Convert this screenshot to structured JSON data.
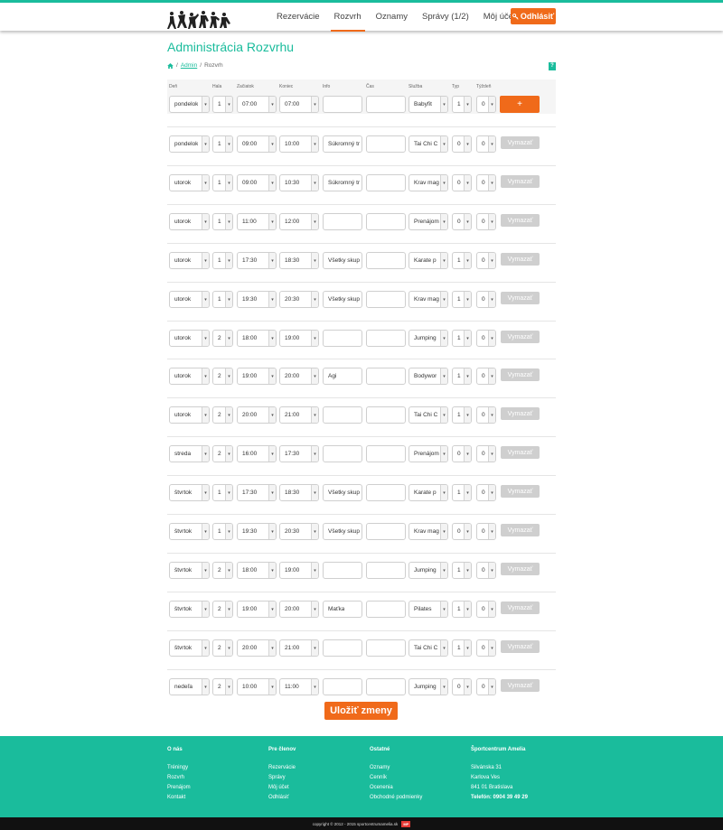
{
  "nav": {
    "items": [
      {
        "label": "Rezervácie",
        "active": false
      },
      {
        "label": "Rozvrh",
        "active": true
      },
      {
        "label": "Oznamy",
        "active": false
      },
      {
        "label": "Správy (1/2)",
        "active": false
      },
      {
        "label": "Môj účet",
        "active": false
      }
    ],
    "logout_label": "Odhlásiť"
  },
  "page": {
    "title": "Administrácia Rozvrhu",
    "breadcrumb": {
      "sep1": "/",
      "admin": "Admin",
      "sep2": "/",
      "current": "Rozvrh"
    },
    "help_label": "?"
  },
  "columns": [
    "Deň",
    "Hala",
    "Začiatok",
    "Koniec",
    "Info",
    "Čas",
    "Služba",
    "Typ",
    "Týždeň"
  ],
  "new_row": {
    "den": "pondelok",
    "hala": "1",
    "zaciatok": "07:00",
    "koniec": "07:00",
    "info": "",
    "cas": "",
    "sluzba": "Babyfit",
    "typ": "1",
    "tyzden": "0",
    "add_label": "+"
  },
  "delete_label": "Vymazať",
  "rows": [
    {
      "den": "pondelok",
      "hala": "1",
      "zaciatok": "09:00",
      "koniec": "10:00",
      "info": "Súkromný tr",
      "cas": "",
      "sluzba": "Tai Chi C",
      "typ": "0",
      "tyzden": "0"
    },
    {
      "den": "utorok",
      "hala": "1",
      "zaciatok": "09:00",
      "koniec": "10:30",
      "info": "Súkromný tr",
      "cas": "",
      "sluzba": "Krav mag",
      "typ": "0",
      "tyzden": "0"
    },
    {
      "den": "utorok",
      "hala": "1",
      "zaciatok": "11:00",
      "koniec": "12:00",
      "info": "",
      "cas": "",
      "sluzba": "Prenájom",
      "typ": "0",
      "tyzden": "0"
    },
    {
      "den": "utorok",
      "hala": "1",
      "zaciatok": "17:30",
      "koniec": "18:30",
      "info": "Všetky skup",
      "cas": "",
      "sluzba": "Karate p",
      "typ": "1",
      "tyzden": "0"
    },
    {
      "den": "utorok",
      "hala": "1",
      "zaciatok": "19:30",
      "koniec": "20:30",
      "info": "Všetky skup",
      "cas": "",
      "sluzba": "Krav mag",
      "typ": "1",
      "tyzden": "0"
    },
    {
      "den": "utorok",
      "hala": "2",
      "zaciatok": "18:00",
      "koniec": "19:00",
      "info": "",
      "cas": "",
      "sluzba": "Jumping",
      "typ": "1",
      "tyzden": "0"
    },
    {
      "den": "utorok",
      "hala": "2",
      "zaciatok": "19:00",
      "koniec": "20:00",
      "info": "Agi",
      "cas": "",
      "sluzba": "Bodywor",
      "typ": "1",
      "tyzden": "0"
    },
    {
      "den": "utorok",
      "hala": "2",
      "zaciatok": "20:00",
      "koniec": "21:00",
      "info": "",
      "cas": "",
      "sluzba": "Tai Chi C",
      "typ": "1",
      "tyzden": "0"
    },
    {
      "den": "streda",
      "hala": "2",
      "zaciatok": "16:00",
      "koniec": "17:30",
      "info": "",
      "cas": "",
      "sluzba": "Prenájom",
      "typ": "0",
      "tyzden": "0"
    },
    {
      "den": "štvrtok",
      "hala": "1",
      "zaciatok": "17:30",
      "koniec": "18:30",
      "info": "Všetky skup",
      "cas": "",
      "sluzba": "Karate p",
      "typ": "1",
      "tyzden": "0"
    },
    {
      "den": "štvrtok",
      "hala": "1",
      "zaciatok": "19:30",
      "koniec": "20:30",
      "info": "Všetky skup",
      "cas": "",
      "sluzba": "Krav mag",
      "typ": "0",
      "tyzden": "0"
    },
    {
      "den": "štvrtok",
      "hala": "2",
      "zaciatok": "18:00",
      "koniec": "19:00",
      "info": "",
      "cas": "",
      "sluzba": "Jumping",
      "typ": "1",
      "tyzden": "0"
    },
    {
      "den": "štvrtok",
      "hala": "2",
      "zaciatok": "19:00",
      "koniec": "20:00",
      "info": "Maťka",
      "cas": "",
      "sluzba": "Pilates",
      "typ": "1",
      "tyzden": "0"
    },
    {
      "den": "štvrtok",
      "hala": "2",
      "zaciatok": "20:00",
      "koniec": "21:00",
      "info": "",
      "cas": "",
      "sluzba": "Tai Chi C",
      "typ": "1",
      "tyzden": "0"
    },
    {
      "den": "nedeľa",
      "hala": "2",
      "zaciatok": "10:00",
      "koniec": "11:00",
      "info": "",
      "cas": "",
      "sluzba": "Jumping",
      "typ": "0",
      "tyzden": "0"
    }
  ],
  "save_label": "Uložiť zmeny",
  "footer": {
    "cols": [
      {
        "title": "O nás",
        "items": [
          "Tréningy",
          "Rozvrh",
          "Prenájom",
          "Kontakt"
        ]
      },
      {
        "title": "Pre členov",
        "items": [
          "Rezervácie",
          "Správy",
          "Môj účet",
          "Odhlásiť"
        ]
      },
      {
        "title": "Ostatné",
        "items": [
          "Oznamy",
          "Cenník",
          "Ocenenia",
          "Obchodné podmienky"
        ]
      },
      {
        "title": "Športcentrum Amelia",
        "items": [
          "Silvánska 31",
          "Karlova Ves",
          "841 01 Bratislava",
          "Telefón: 0904 39 49 29"
        ]
      }
    ],
    "copyright": "copyright © 2012 - 2015 sportcentrumamelia.sk",
    "badge": "MP"
  },
  "colors": {
    "accent": "#1abc9c",
    "orange": "#f06a1a",
    "disabled": "#cfcfcf"
  },
  "icons": {
    "home": "home-icon",
    "key": "key-icon",
    "caret": "chevron-down-icon"
  }
}
